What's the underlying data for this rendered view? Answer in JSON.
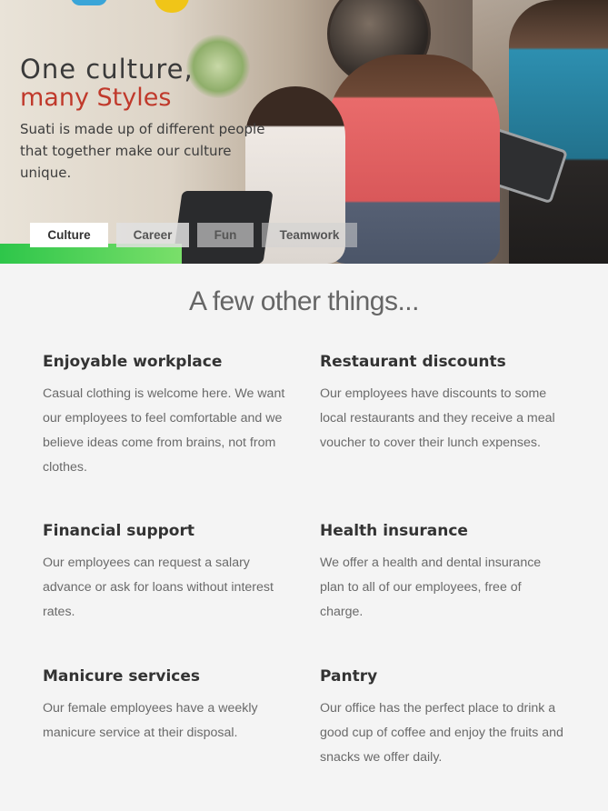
{
  "hero": {
    "title_line1": "One culture,",
    "title_line2": "many Styles",
    "subtitle": "Suati is made up of different people that together make our culture unique.",
    "tabs": [
      {
        "label": "Culture",
        "active": true
      },
      {
        "label": "Career",
        "active": false
      },
      {
        "label": "Fun",
        "active": false
      },
      {
        "label": "Teamwork",
        "active": false
      }
    ]
  },
  "section": {
    "title": "A few other things...",
    "items": [
      {
        "title": "Enjoyable workplace",
        "text": "Casual clothing is welcome here. We want our employees to feel comfortable and we believe ideas come from brains, not from clothes."
      },
      {
        "title": "Restaurant discounts",
        "text": "Our employees have discounts to some local restaurants and they receive a meal voucher to cover their lunch expenses."
      },
      {
        "title": "Financial support",
        "text": "Our employees can request a salary advance or ask for loans without interest rates."
      },
      {
        "title": "Health insurance",
        "text": "We offer a health and dental insurance plan to all of our employees, free of charge."
      },
      {
        "title": "Manicure services",
        "text": "Our female employees have a weekly manicure service at their disposal."
      },
      {
        "title": "Pantry",
        "text": "Our office has the perfect place to drink a good cup of coffee and enjoy the fruits and snacks we offer daily."
      }
    ]
  },
  "colors": {
    "accent": "#c0392b",
    "background": "#f4f4f4"
  }
}
